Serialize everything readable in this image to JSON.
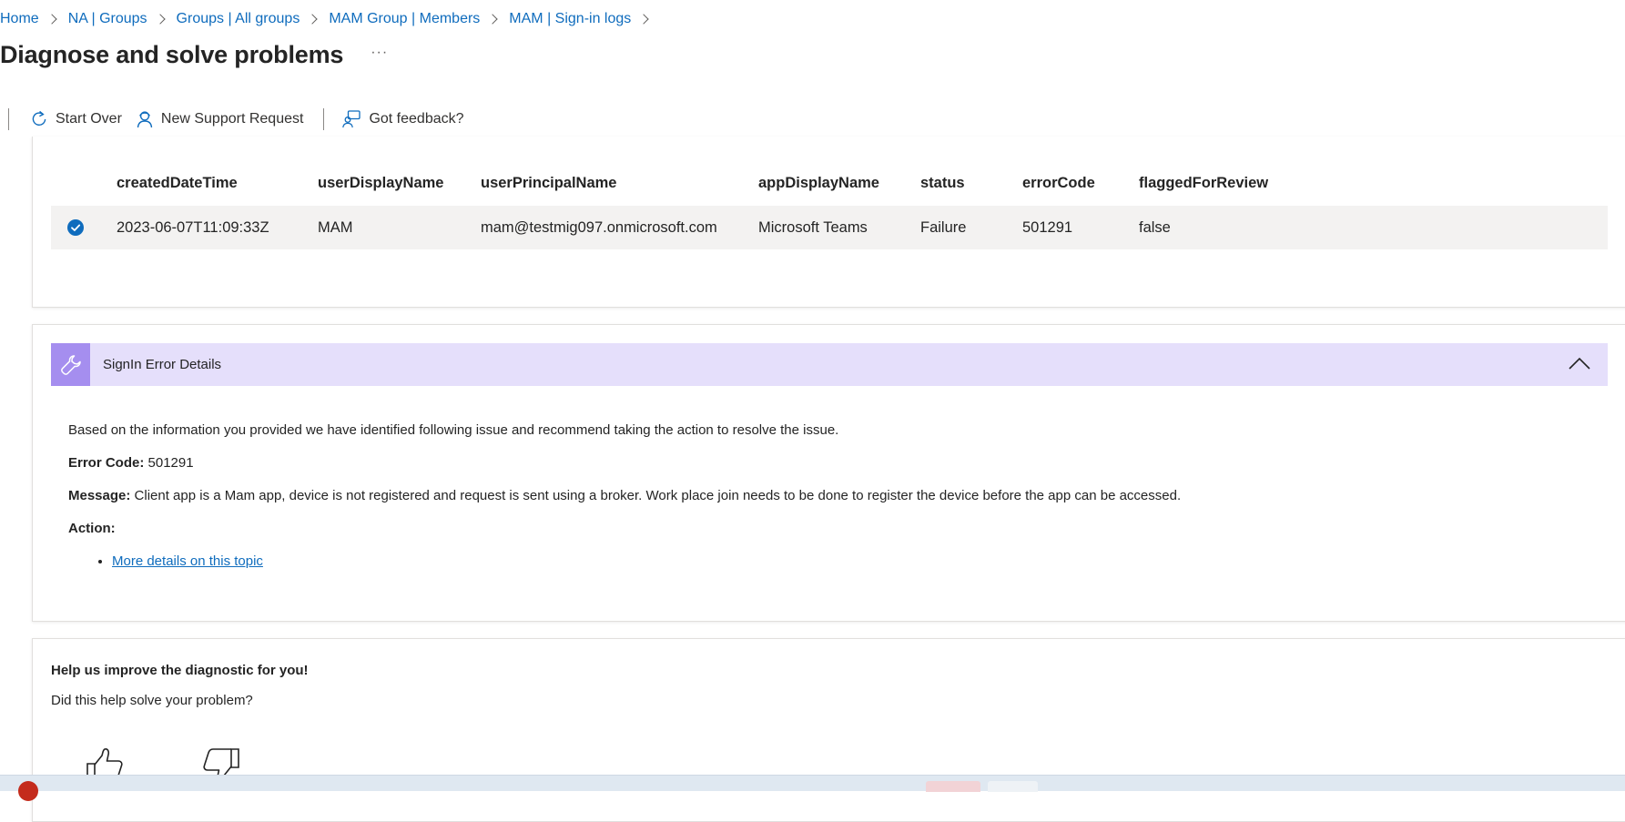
{
  "breadcrumb": [
    {
      "label": "Home"
    },
    {
      "label": "NA | Groups"
    },
    {
      "label": "Groups | All groups"
    },
    {
      "label": "MAM Group | Members"
    },
    {
      "label": "MAM | Sign-in logs"
    }
  ],
  "page": {
    "title": "Diagnose and solve problems",
    "more_label": "···"
  },
  "toolbar": {
    "start_over": "Start Over",
    "new_support_request": "New Support Request",
    "feedback": "Got feedback?"
  },
  "table": {
    "columns": [
      "createdDateTime",
      "userDisplayName",
      "userPrincipalName",
      "appDisplayName",
      "status",
      "errorCode",
      "flaggedForReview"
    ],
    "rows": [
      {
        "selected": true,
        "cells": [
          "2023-06-07T11:09:33Z",
          "MAM",
          "mam@testmig097.onmicrosoft.com",
          "Microsoft Teams",
          "Failure",
          "501291",
          "false"
        ]
      }
    ]
  },
  "details": {
    "title": "SignIn Error Details",
    "intro": "Based on the information you provided we have identified following issue and recommend taking the action to resolve the issue.",
    "error_code_label": "Error Code:",
    "error_code_value": " 501291",
    "message_label": "Message:",
    "message_value": " Client app is a Mam app, device is not registered and request is sent using a broker. Work place join needs to be done to register the device before the app can be accessed.",
    "action_label": "Action:",
    "link_text": "More details on this topic"
  },
  "feedback": {
    "title": "Help us improve the diagnostic for you!",
    "question": "Did this help solve your problem?"
  },
  "colors": {
    "link": "#0f6cbd",
    "section_header_bg": "#e5dffb",
    "section_icon_bg": "#a58eef",
    "row_selected_bg": "#f3f2f1"
  },
  "icons": [
    "chevron-right-icon",
    "refresh-icon",
    "person-support-icon",
    "feedback-person-icon",
    "checkmark-circle-icon",
    "wrench-icon",
    "chevron-up-icon",
    "thumbs-up-icon",
    "thumbs-down-icon"
  ]
}
